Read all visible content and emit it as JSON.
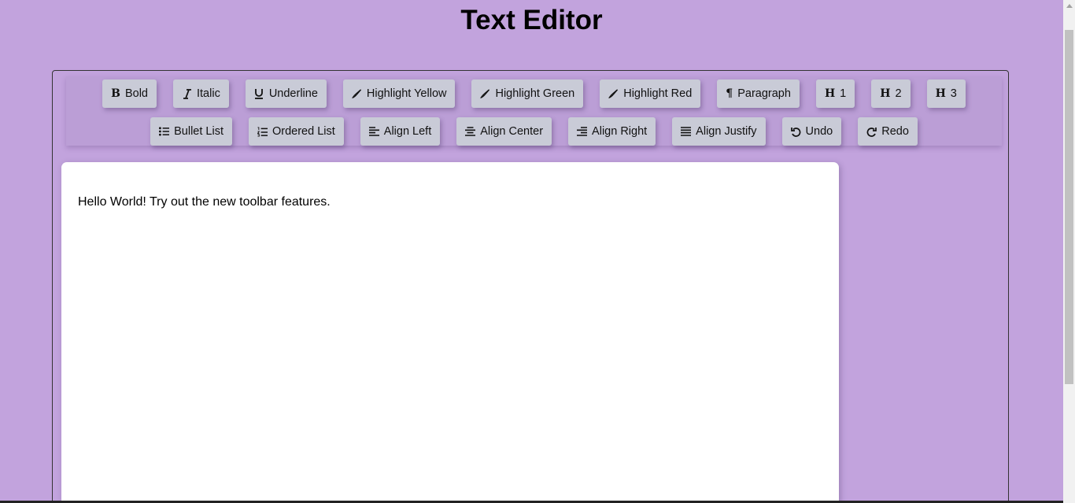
{
  "page": {
    "title": "Text Editor"
  },
  "toolbar": {
    "row1": [
      {
        "label": "Bold",
        "icon": "bold-icon"
      },
      {
        "label": "Italic",
        "icon": "italic-icon"
      },
      {
        "label": "Underline",
        "icon": "underline-icon"
      },
      {
        "label": "Highlight Yellow",
        "icon": "highlighter-icon"
      },
      {
        "label": "Highlight Green",
        "icon": "highlighter-icon"
      },
      {
        "label": "Highlight Red",
        "icon": "highlighter-icon"
      },
      {
        "label": "Paragraph",
        "icon": "paragraph-icon"
      },
      {
        "label": "1",
        "icon": "heading-icon"
      },
      {
        "label": "2",
        "icon": "heading-icon"
      },
      {
        "label": "3",
        "icon": "heading-icon"
      }
    ],
    "row2": [
      {
        "label": "Bullet List",
        "icon": "bullet-list-icon"
      },
      {
        "label": "Ordered List",
        "icon": "ordered-list-icon"
      },
      {
        "label": "Align Left",
        "icon": "align-left-icon"
      },
      {
        "label": "Align Center",
        "icon": "align-center-icon"
      },
      {
        "label": "Align Right",
        "icon": "align-right-icon"
      },
      {
        "label": "Align Justify",
        "icon": "align-justify-icon"
      },
      {
        "label": "Undo",
        "icon": "undo-icon"
      },
      {
        "label": "Redo",
        "icon": "redo-icon"
      }
    ]
  },
  "editor": {
    "content": "Hello World! Try out the new toolbar features."
  },
  "colors": {
    "background": "#c2a3dd",
    "button": "#c9cbd7",
    "editor": "#ffffff"
  }
}
